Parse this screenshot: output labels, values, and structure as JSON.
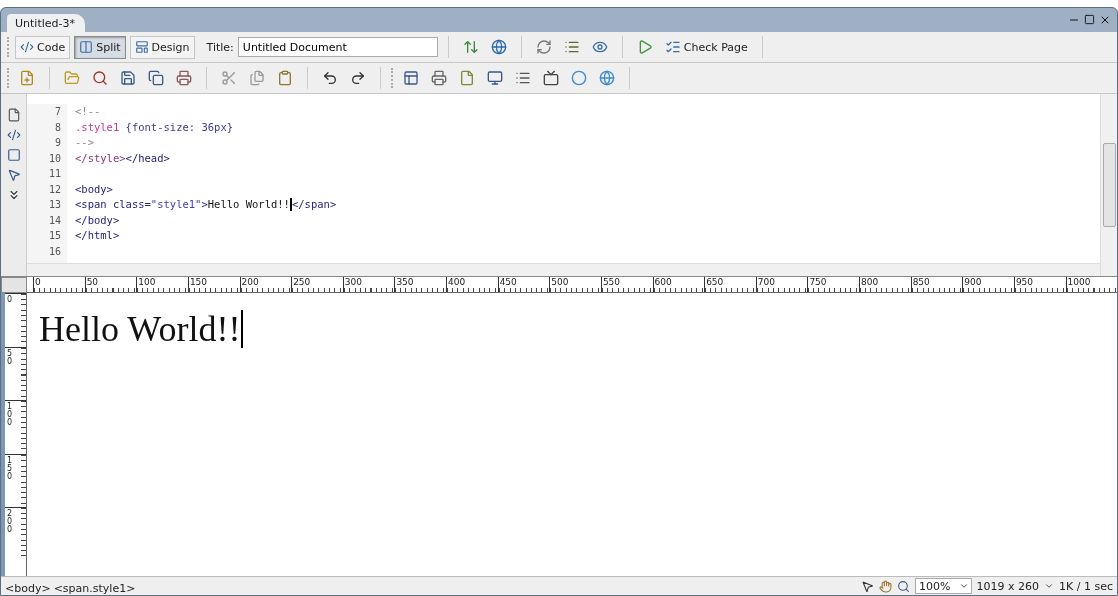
{
  "window": {
    "tab": "Untitled-3*"
  },
  "document_toolbar": {
    "views": [
      {
        "label": "Code",
        "kind": "code",
        "selected": false
      },
      {
        "label": "Split",
        "kind": "split",
        "selected": true
      },
      {
        "label": "Design",
        "kind": "design",
        "selected": false
      }
    ],
    "title_label": "Title:",
    "title_value": "Untitled Document",
    "check_page": "Check Page"
  },
  "code_view": {
    "lines": [
      {
        "number": "7",
        "tokens": [
          {
            "text": "<!--",
            "kind": "comment"
          }
        ]
      },
      {
        "number": "8",
        "tokens": [
          {
            "text": ".style1 ",
            "kind": "selector"
          },
          {
            "text": "{font-size: 36px}",
            "kind": "rule"
          }
        ]
      },
      {
        "number": "9",
        "tokens": [
          {
            "text": "-->",
            "kind": "comment"
          }
        ]
      },
      {
        "number": "10",
        "tokens": [
          {
            "text": "</style>",
            "kind": "style"
          },
          {
            "text": "</head>",
            "kind": "tag"
          }
        ]
      },
      {
        "number": "11"
      },
      {
        "number": "12",
        "tokens": [
          {
            "text": "<body>",
            "kind": "tag"
          }
        ]
      },
      {
        "number": "13",
        "tokens": [
          {
            "text": "<span class=",
            "kind": "tag"
          },
          {
            "text": "\"style1\"",
            "kind": "string"
          },
          {
            "text": ">",
            "kind": "tag"
          },
          {
            "text": "Hello World!!",
            "kind": "text"
          },
          {
            "kind": "caret"
          },
          {
            "text": "</span>",
            "kind": "tag"
          }
        ]
      },
      {
        "number": "14",
        "tokens": [
          {
            "text": "</body>",
            "kind": "tag"
          }
        ]
      },
      {
        "number": "15",
        "tokens": [
          {
            "text": "</html>",
            "kind": "tag"
          }
        ]
      },
      {
        "number": "16"
      }
    ]
  },
  "rulers": {
    "horizontal": [
      "0",
      "50",
      "100",
      "150",
      "200",
      "250",
      "300",
      "350",
      "400",
      "450",
      "500",
      "550",
      "600",
      "650",
      "700",
      "750",
      "800",
      "850",
      "900",
      "950",
      "1000"
    ],
    "vertical": [
      "0",
      "50",
      "100",
      "150",
      "200"
    ]
  },
  "design_view": {
    "text": "Hello World!!"
  },
  "status_bar": {
    "tags": [
      "<body>",
      "<span.style1>"
    ],
    "zoom": "100%",
    "window_size": "1019 x 260",
    "download": "1K / 1 sec"
  }
}
